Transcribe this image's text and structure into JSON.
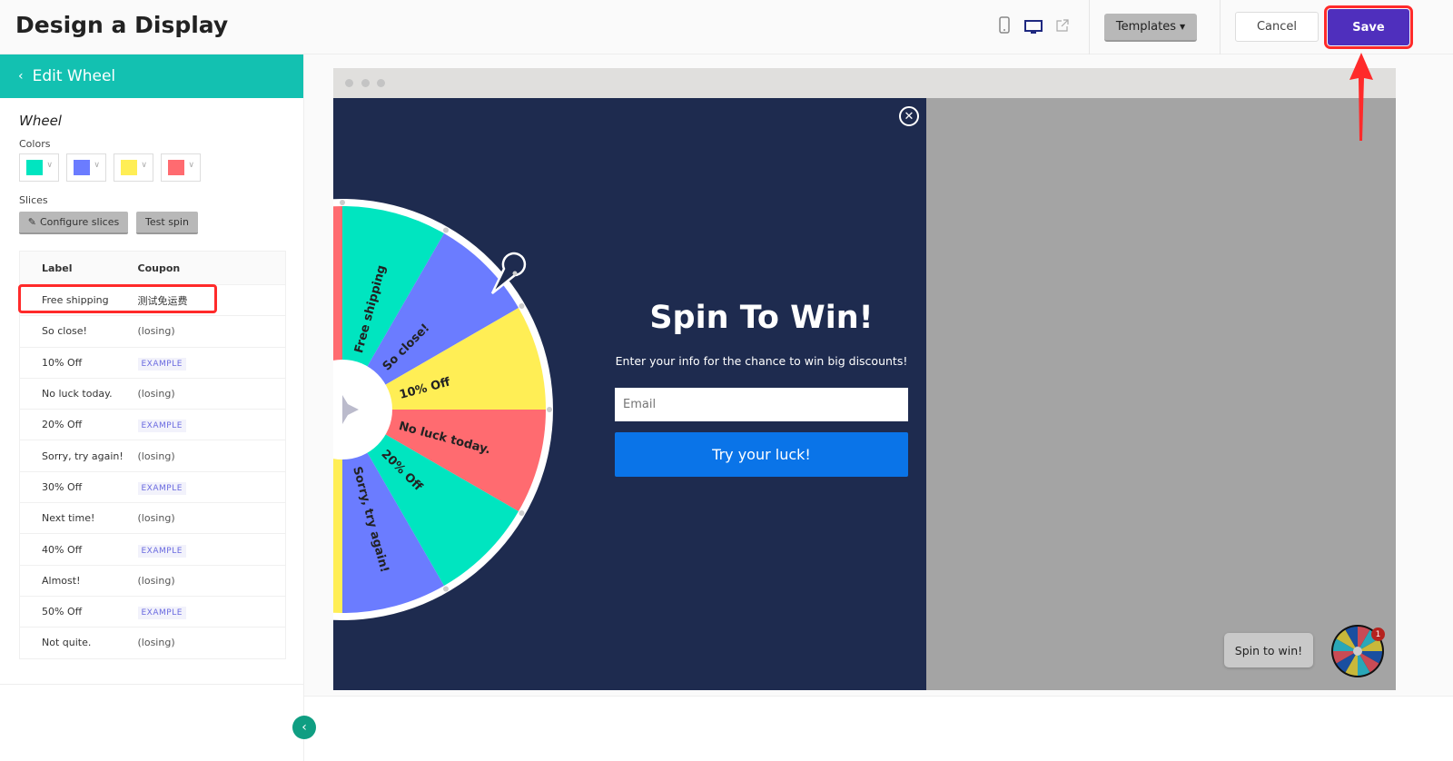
{
  "header": {
    "title": "Design a Display",
    "templates_label": "Templates",
    "cancel_label": "Cancel",
    "save_label": "Save",
    "icons": [
      "mobile-icon",
      "desktop-icon",
      "external-link-icon"
    ]
  },
  "sidebar": {
    "back_label": "Edit Wheel",
    "section_title": "Wheel",
    "colors_label": "Colors",
    "colors": [
      "#00e5c0",
      "#6b7cff",
      "#ffee55",
      "#ff6b70"
    ],
    "slices_label": "Slices",
    "configure_label": "Configure slices",
    "test_label": "Test spin",
    "table": {
      "headers": [
        "Label",
        "Coupon"
      ],
      "rows": [
        {
          "label": "Free shipping",
          "coupon": "测试免运费",
          "type": "text"
        },
        {
          "label": "So close!",
          "coupon": "(losing)",
          "type": "text"
        },
        {
          "label": "10% Off",
          "coupon": "EXAMPLE",
          "type": "badge"
        },
        {
          "label": "No luck today.",
          "coupon": "(losing)",
          "type": "text"
        },
        {
          "label": "20% Off",
          "coupon": "EXAMPLE",
          "type": "badge"
        },
        {
          "label": "Sorry, try again!",
          "coupon": "(losing)",
          "type": "text"
        },
        {
          "label": "30% Off",
          "coupon": "EXAMPLE",
          "type": "badge"
        },
        {
          "label": "Next time!",
          "coupon": "(losing)",
          "type": "text"
        },
        {
          "label": "40% Off",
          "coupon": "EXAMPLE",
          "type": "badge"
        },
        {
          "label": "Almost!",
          "coupon": "(losing)",
          "type": "text"
        },
        {
          "label": "50% Off",
          "coupon": "EXAMPLE",
          "type": "badge"
        },
        {
          "label": "Not quite.",
          "coupon": "(losing)",
          "type": "text"
        }
      ]
    }
  },
  "popup": {
    "title": "Spin To Win!",
    "subtitle": "Enter your info for the chance to win big discounts!",
    "email_placeholder": "Email",
    "cta_label": "Try your luck!",
    "wheel_labels": [
      "Free shipping",
      "So close!",
      "10% Off",
      "No luck today.",
      "20% Off",
      "Sorry, try again!"
    ]
  },
  "teaser": {
    "label": "Spin to win!",
    "badge": "1"
  },
  "accent": {
    "save": "#4f2fbd",
    "cta": "#0a74e8",
    "header": "#13c1b1",
    "highlight": "#ff2a2a"
  }
}
